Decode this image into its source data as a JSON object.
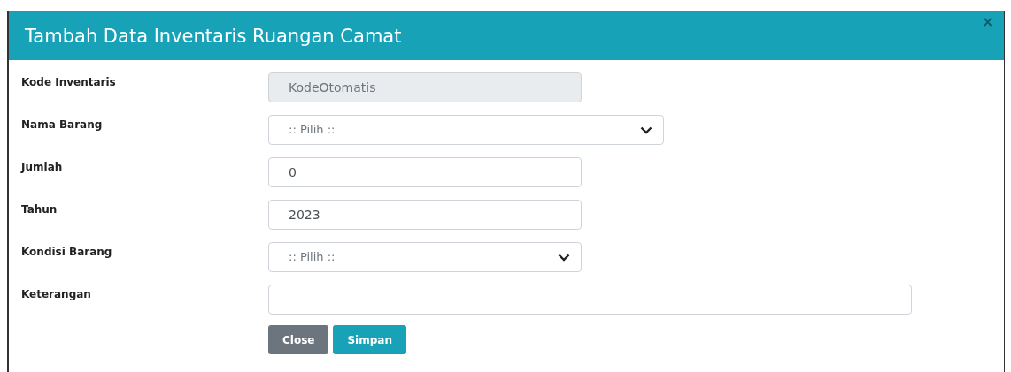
{
  "dialog": {
    "title": "Tambah Data Inventaris Ruangan Camat",
    "close_glyph": "×"
  },
  "fields": [
    {
      "label": "Kode Inventaris",
      "kind": "text",
      "value": "KodeOtomatis",
      "disabled": true
    },
    {
      "label": "Nama Barang",
      "kind": "select",
      "value": ":: Pilih ::",
      "disabled": false
    },
    {
      "label": "Jumlah",
      "kind": "text",
      "value": "0",
      "disabled": false
    },
    {
      "label": "Tahun",
      "kind": "text",
      "value": "2023",
      "disabled": false
    },
    {
      "label": "Kondisi Barang",
      "kind": "select",
      "value": ":: Pilih ::",
      "disabled": false
    },
    {
      "label": "Keterangan",
      "kind": "text",
      "disabled": false
    }
  ],
  "buttons": [
    {
      "label": "Close",
      "kind": "secondary"
    },
    {
      "label": "Simpan",
      "kind": "primary"
    }
  ]
}
